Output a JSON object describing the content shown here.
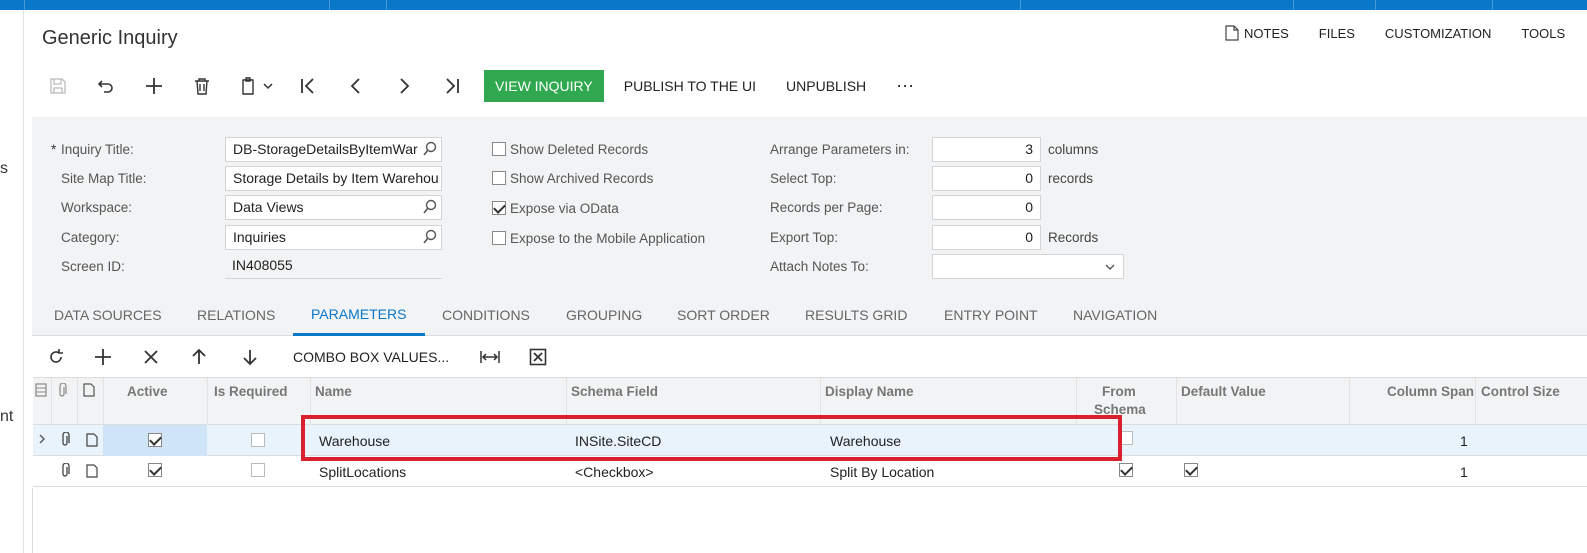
{
  "page": {
    "title": "Generic Inquiry"
  },
  "left_strip": {
    "fragment_1": "s",
    "fragment_2": "nt"
  },
  "top_links": {
    "notes": "NOTES",
    "files": "FILES",
    "customization": "CUSTOMIZATION",
    "tools": "TOOLS"
  },
  "toolbar": {
    "view_inquiry": "VIEW INQUIRY",
    "publish": "PUBLISH TO THE UI",
    "unpublish": "UNPUBLISH",
    "more": "···"
  },
  "form": {
    "inquiry_title_label": "Inquiry Title:",
    "inquiry_title_value": "DB-StorageDetailsByItemWar",
    "site_map_title_label": "Site Map Title:",
    "site_map_title_value": "Storage Details by Item Warehou",
    "workspace_label": "Workspace:",
    "workspace_value": "Data Views",
    "category_label": "Category:",
    "category_value": "Inquiries",
    "screen_id_label": "Screen ID:",
    "screen_id_value": "IN408055",
    "show_deleted": "Show Deleted Records",
    "show_archived": "Show Archived Records",
    "expose_odata": "Expose via OData",
    "expose_mobile": "Expose to the Mobile Application",
    "arrange_label": "Arrange Parameters in:",
    "arrange_value": "3",
    "arrange_unit": "columns",
    "select_top_label": "Select Top:",
    "select_top_value": "0",
    "select_top_unit": "records",
    "rpp_label": "Records per Page:",
    "rpp_value": "0",
    "export_top_label": "Export Top:",
    "export_top_value": "0",
    "export_top_unit": "Records",
    "attach_notes_label": "Attach Notes To:",
    "attach_notes_value": ""
  },
  "tabs": [
    "DATA SOURCES",
    "RELATIONS",
    "PARAMETERS",
    "CONDITIONS",
    "GROUPING",
    "SORT ORDER",
    "RESULTS GRID",
    "ENTRY POINT",
    "NAVIGATION"
  ],
  "grid_toolbar": {
    "combo_box_values": "COMBO BOX VALUES..."
  },
  "grid": {
    "headers": {
      "active": "Active",
      "is_required": "Is Required",
      "name": "Name",
      "schema_field": "Schema Field",
      "display_name": "Display Name",
      "from_schema_1": "From",
      "from_schema_2": "Schema",
      "default_value": "Default Value",
      "column_span": "Column Span",
      "control_size": "Control Size"
    },
    "rows": [
      {
        "active": true,
        "is_required": false,
        "name": "Warehouse",
        "schema_field": "INSite.SiteCD",
        "display_name": "Warehouse",
        "from_schema": false,
        "default_value": false,
        "column_span": "1"
      },
      {
        "active": true,
        "is_required": false,
        "name": "SplitLocations",
        "schema_field": "<Checkbox>",
        "display_name": "Split By Location",
        "from_schema": true,
        "default_value": true,
        "column_span": "1"
      }
    ]
  },
  "colors": {
    "accent": "#0a78c9",
    "green": "#2fa84f",
    "highlight": "#d9202e"
  }
}
